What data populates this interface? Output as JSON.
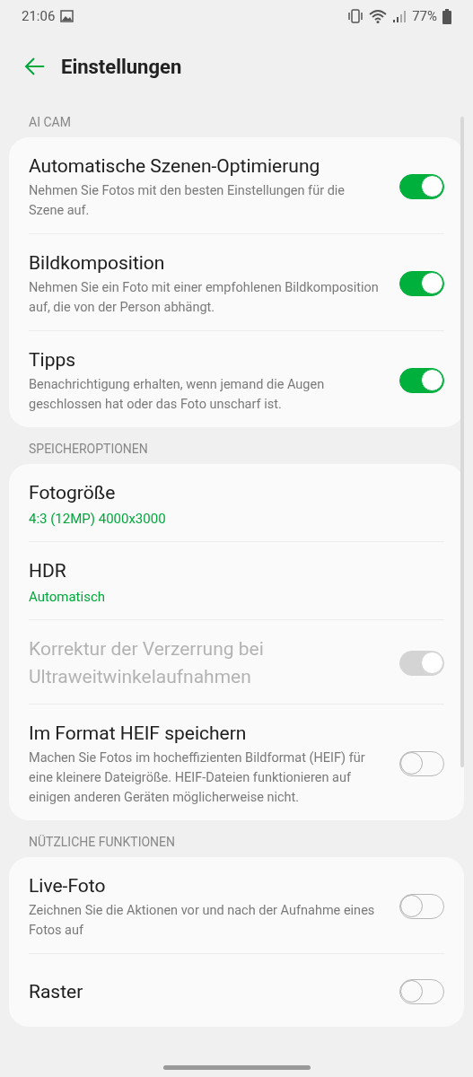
{
  "status_bar": {
    "time": "21:06",
    "battery": "77%"
  },
  "header": {
    "title": "Einstellungen"
  },
  "sections": [
    {
      "label": "AI CAM",
      "items": [
        {
          "kind": "toggle",
          "title": "Automatische Szenen-Optimierung",
          "subtitle": "Nehmen Sie Fotos mit den besten Einstellungen für die Szene auf.",
          "on": true,
          "disabled": false
        },
        {
          "kind": "toggle",
          "title": "Bildkomposition",
          "subtitle": "Nehmen Sie ein Foto mit einer empfohlenen Bildkomposition auf, die von der Person abhängt.",
          "on": true,
          "disabled": false
        },
        {
          "kind": "toggle",
          "title": "Tipps",
          "subtitle": "Benachrichtigung erhalten, wenn jemand die Augen geschlossen hat oder das Foto unscharf ist.",
          "on": true,
          "disabled": false
        }
      ]
    },
    {
      "label": "SPEICHEROPTIONEN",
      "items": [
        {
          "kind": "value",
          "title": "Fotogröße",
          "value": "4:3 (12MP) 4000x3000"
        },
        {
          "kind": "value",
          "title": "HDR",
          "value": "Automatisch"
        },
        {
          "kind": "toggle",
          "title": "Korrektur der Verzerrung bei Ultraweitwinkelaufnahmen",
          "on": true,
          "disabled": true
        },
        {
          "kind": "toggle",
          "title": "Im Format HEIF speichern",
          "subtitle": "Machen Sie Fotos im hocheffizienten Bildformat (HEIF) für eine kleinere Dateigröße. HEIF-Dateien funktionieren auf einigen anderen Geräten möglicherweise nicht.",
          "on": false,
          "disabled": false
        }
      ]
    },
    {
      "label": "NÜTZLICHE FUNKTIONEN",
      "items": [
        {
          "kind": "toggle",
          "title": "Live-Foto",
          "subtitle": "Zeichnen Sie die Aktionen vor und nach der Aufnahme eines Fotos auf",
          "on": false,
          "disabled": false
        },
        {
          "kind": "toggle",
          "title": "Raster",
          "on": false,
          "disabled": false
        }
      ]
    }
  ]
}
